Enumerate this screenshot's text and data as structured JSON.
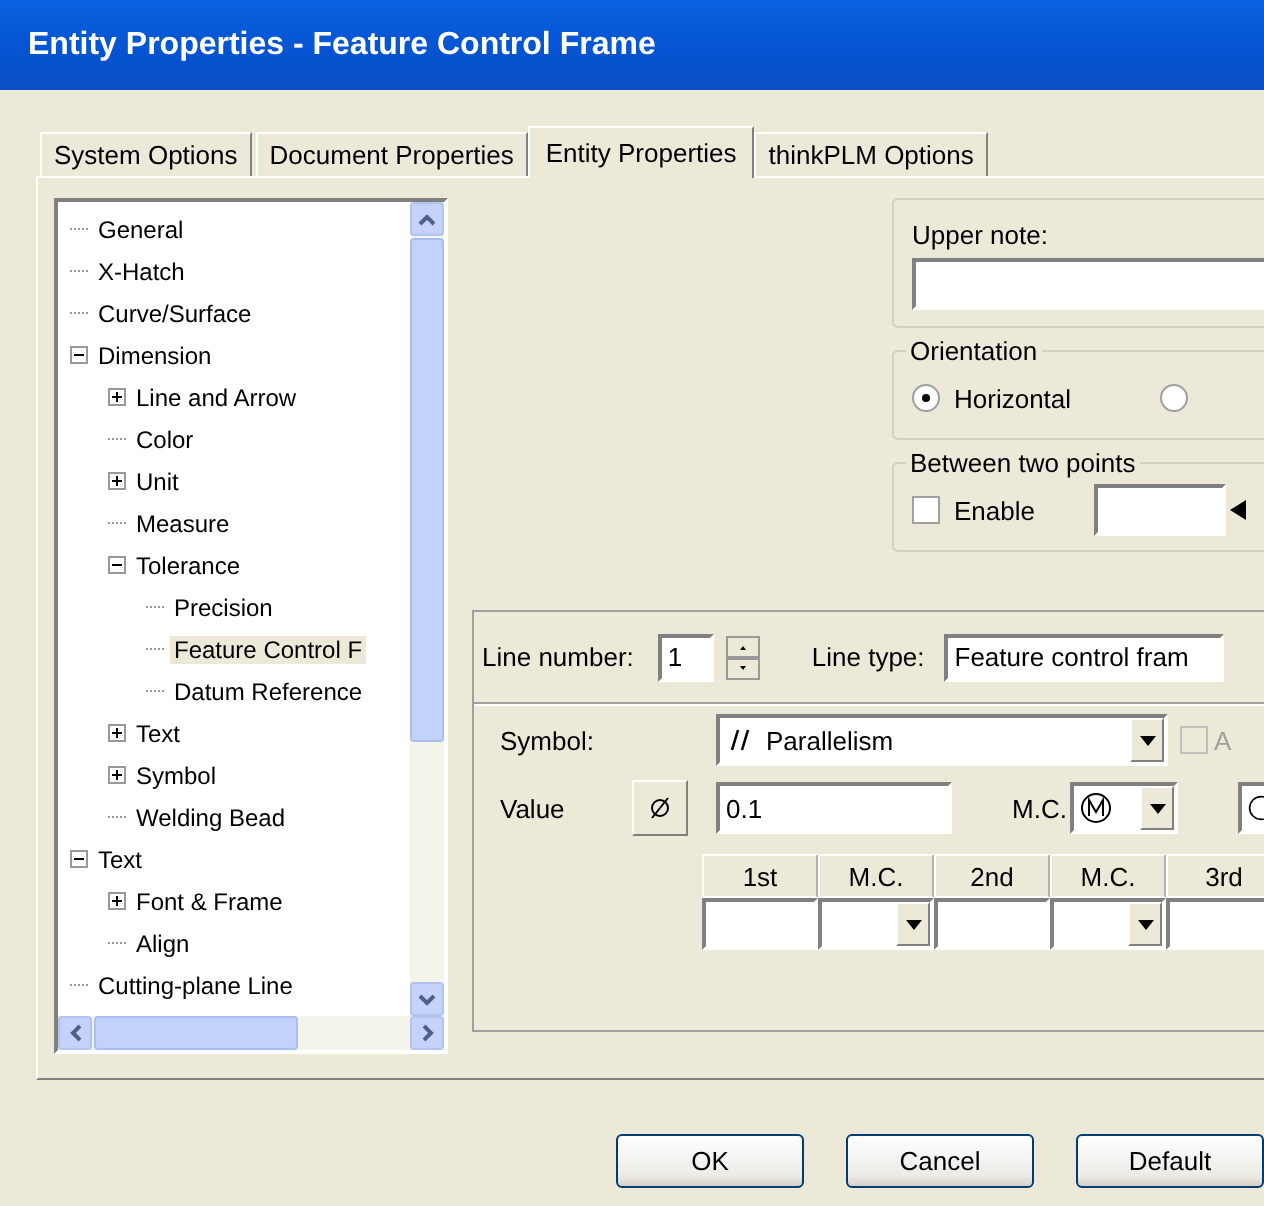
{
  "window": {
    "title": "Entity Properties - Feature Control Frame"
  },
  "tabs": [
    {
      "label": "System Options",
      "selected": false
    },
    {
      "label": "Document Properties",
      "selected": false
    },
    {
      "label": "Entity Properties",
      "selected": true
    },
    {
      "label": "thinkPLM Options",
      "selected": false
    }
  ],
  "tree": {
    "items": [
      {
        "label": "General"
      },
      {
        "label": "X-Hatch"
      },
      {
        "label": "Curve/Surface"
      },
      {
        "label": "Dimension",
        "expanded": true,
        "children": [
          {
            "label": "Line and Arrow",
            "expanded": false
          },
          {
            "label": "Color"
          },
          {
            "label": "Unit",
            "expanded": false
          },
          {
            "label": "Measure"
          },
          {
            "label": "Tolerance",
            "expanded": true,
            "children": [
              {
                "label": "Precision",
                "selected": false
              },
              {
                "label": "Feature Control F",
                "selected": true
              },
              {
                "label": "Datum Reference",
                "selected": false
              }
            ]
          },
          {
            "label": "Text",
            "expanded": false
          },
          {
            "label": "Symbol",
            "expanded": false
          },
          {
            "label": "Welding Bead"
          }
        ]
      },
      {
        "label": "Text",
        "expanded": true,
        "children": [
          {
            "label": "Font & Frame",
            "expanded": false
          },
          {
            "label": "Align"
          }
        ]
      },
      {
        "label": "Cutting-plane Line"
      }
    ]
  },
  "upper_note": {
    "label": "Upper note:"
  },
  "orientation": {
    "label": "Orientation",
    "options": [
      {
        "label": "Horizontal",
        "selected": true
      },
      {
        "selected": false
      }
    ]
  },
  "between_two_points": {
    "label": "Between two points",
    "enable": {
      "label": "Enable",
      "checked": false
    }
  },
  "line_number": {
    "label": "Line number:",
    "value": "1"
  },
  "line_type": {
    "label": "Line type:",
    "value": "Feature control fram"
  },
  "symbol": {
    "label": "Symbol:",
    "value": "Parallelism"
  },
  "side_option": {
    "label": "A",
    "checked": false,
    "disabled": true
  },
  "value": {
    "label": "Value",
    "value": "0.1"
  },
  "material_condition": {
    "label": "M.C."
  },
  "datum_table": {
    "columns": [
      {
        "label": "1st",
        "kind": "text"
      },
      {
        "label": "M.C.",
        "kind": "select"
      },
      {
        "label": "2nd",
        "kind": "text"
      },
      {
        "label": "M.C.",
        "kind": "select"
      },
      {
        "label": "3rd",
        "kind": "text"
      }
    ]
  },
  "buttons": [
    "OK",
    "Cancel",
    "Default"
  ]
}
